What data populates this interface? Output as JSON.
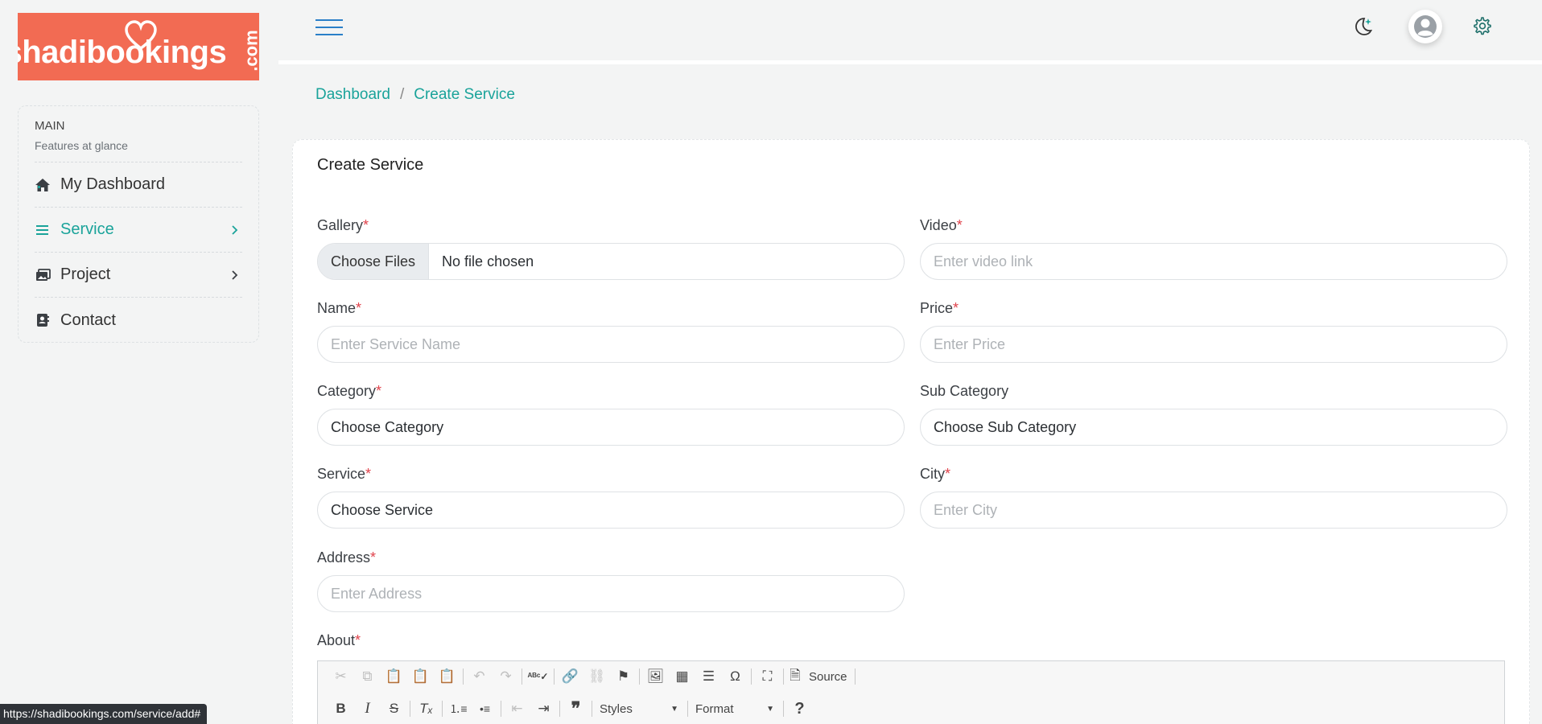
{
  "brand": {
    "logo_text": "shadibookings",
    "logo_suffix": ".com",
    "logo_color": "#f26b53"
  },
  "sidebar": {
    "heading": "MAIN",
    "subheading": "Features at glance",
    "items": [
      {
        "label": "My Dashboard",
        "icon": "home-icon",
        "active": false
      },
      {
        "label": "Service",
        "icon": "list-icon",
        "active": true
      },
      {
        "label": "Project",
        "icon": "images-icon",
        "active": false
      },
      {
        "label": "Contact",
        "icon": "contact-book-icon",
        "active": false
      }
    ]
  },
  "topbar": {
    "icons": [
      "menu-icon",
      "moon-icon",
      "user-avatar-icon",
      "gear-icon"
    ]
  },
  "breadcrumb": {
    "items": [
      "Dashboard",
      "Create Service"
    ],
    "separator": "/"
  },
  "form": {
    "title": "Create Service",
    "required_mark": "*",
    "gallery": {
      "label": "Gallery",
      "button": "Choose Files",
      "status": "No file chosen"
    },
    "video": {
      "label": "Video",
      "placeholder": "Enter video link"
    },
    "name": {
      "label": "Name",
      "placeholder": "Enter Service Name"
    },
    "price": {
      "label": "Price",
      "placeholder": "Enter Price"
    },
    "category": {
      "label": "Category",
      "value": "Choose Category"
    },
    "subcategory": {
      "label": "Sub Category",
      "value": "Choose Sub Category"
    },
    "service": {
      "label": "Service",
      "value": "Choose Service"
    },
    "city": {
      "label": "City",
      "placeholder": "Enter City"
    },
    "address": {
      "label": "Address",
      "placeholder": "Enter Address"
    },
    "about": {
      "label": "About"
    }
  },
  "editor": {
    "source_label": "Source",
    "styles_label": "Styles",
    "format_label": "Format"
  },
  "status_url": "https://shadibookings.com/service/add#",
  "colors": {
    "accent": "#1aa39a",
    "required": "#e0424b",
    "hamburger": "#2a7fc8"
  }
}
